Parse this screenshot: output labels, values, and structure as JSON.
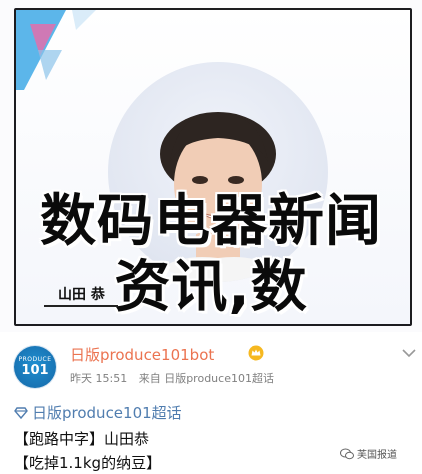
{
  "image": {
    "overlay_line1": "数码电器新闻",
    "overlay_line2": "资讯,数",
    "name_caption": "山田 恭"
  },
  "post": {
    "avatar": {
      "small": "PRODUCE",
      "big": "101"
    },
    "username": "日版produce101bot",
    "badge_icon": "vip-crown-icon",
    "meta": {
      "date": "昨天 15:51",
      "source": "来自 日版produce101超话"
    },
    "supertopic": "日版produce101超话",
    "lines": [
      "【跑路中字】山田恭",
      "【吃掉1.1kg的纳豆】"
    ],
    "watermark": "芙国报道"
  },
  "colors": {
    "username": "#eb7350",
    "supertopic": "#507daf",
    "avatar": "#1f8fd0"
  }
}
